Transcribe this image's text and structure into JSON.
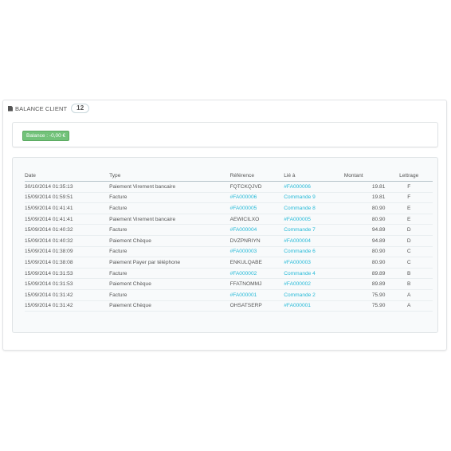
{
  "panel": {
    "title": "BALANCE CLIENT",
    "count": "12",
    "balance_label": "Balance : -0,00 €"
  },
  "table": {
    "headers": [
      "Date",
      "Type",
      "Référence",
      "Lié à",
      "Montant",
      "Lettrage"
    ],
    "rows": [
      {
        "date": "30/10/2014 01:35:13",
        "type": "Paiement Virement bancaire",
        "ref": "FQTCKQJVD",
        "ref_link": false,
        "lie": "#FA000006",
        "montant": "19.81",
        "lettrage": "F"
      },
      {
        "date": "15/09/2014 01:59:51",
        "type": "Facture",
        "ref": "#FA000006",
        "ref_link": true,
        "lie": "Commande 9",
        "montant": "19.81",
        "lettrage": "F"
      },
      {
        "date": "15/09/2014 01:41:41",
        "type": "Facture",
        "ref": "#FA000005",
        "ref_link": true,
        "lie": "Commande 8",
        "montant": "80.90",
        "lettrage": "E"
      },
      {
        "date": "15/09/2014 01:41:41",
        "type": "Paiement Virement bancaire",
        "ref": "AEWICILXO",
        "ref_link": false,
        "lie": "#FA000005",
        "montant": "80.90",
        "lettrage": "E"
      },
      {
        "date": "15/09/2014 01:40:32",
        "type": "Facture",
        "ref": "#FA000004",
        "ref_link": true,
        "lie": "Commande 7",
        "montant": "94.89",
        "lettrage": "D"
      },
      {
        "date": "15/09/2014 01:40:32",
        "type": "Paiement Chèque",
        "ref": "DVZPNRIYN",
        "ref_link": false,
        "lie": "#FA000004",
        "montant": "94.89",
        "lettrage": "D"
      },
      {
        "date": "15/09/2014 01:38:09",
        "type": "Facture",
        "ref": "#FA000003",
        "ref_link": true,
        "lie": "Commande 6",
        "montant": "80.90",
        "lettrage": "C"
      },
      {
        "date": "15/09/2014 01:38:08",
        "type": "Paiement Payer par téléphone",
        "ref": "ENKULQABE",
        "ref_link": false,
        "lie": "#FA000003",
        "montant": "80.90",
        "lettrage": "C"
      },
      {
        "date": "15/09/2014 01:31:53",
        "type": "Facture",
        "ref": "#FA000002",
        "ref_link": true,
        "lie": "Commande 4",
        "montant": "89.89",
        "lettrage": "B"
      },
      {
        "date": "15/09/2014 01:31:53",
        "type": "Paiement Chèque",
        "ref": "FFATNOMMJ",
        "ref_link": false,
        "lie": "#FA000002",
        "montant": "89.89",
        "lettrage": "B"
      },
      {
        "date": "15/09/2014 01:31:42",
        "type": "Facture",
        "ref": "#FA000001",
        "ref_link": true,
        "lie": "Commande 2",
        "montant": "75.90",
        "lettrage": "A"
      },
      {
        "date": "15/09/2014 01:31:42",
        "type": "Paiement Chèque",
        "ref": "OHSATSERP",
        "ref_link": false,
        "lie": "#FA000001",
        "montant": "75.90",
        "lettrage": "A"
      }
    ]
  },
  "colors": {
    "link": "#25b9d7",
    "badge_green": "#72c279",
    "text": "#555555"
  },
  "icons": {
    "heading": "file-icon"
  }
}
